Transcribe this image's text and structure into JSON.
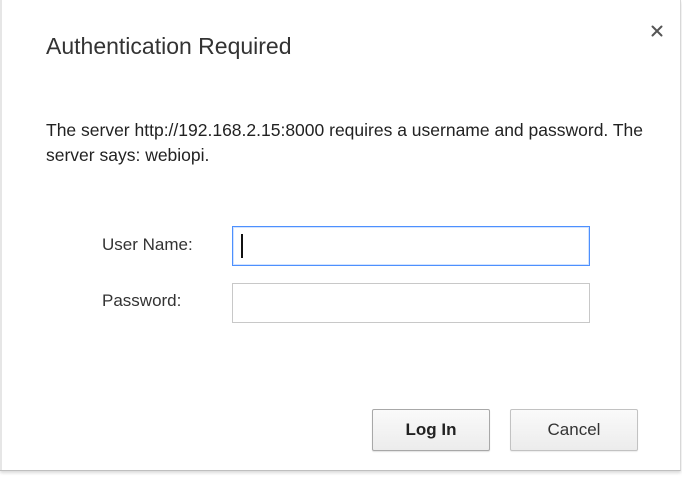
{
  "dialog": {
    "title": "Authentication Required",
    "message": "The server http://192.168.2.15:8000 requires a username and password. The server says: webiopi.",
    "close_icon": "close-icon",
    "colors": {
      "focus_border": "#4d90fe",
      "input_border": "#c8c8c8"
    }
  },
  "form": {
    "username_label": "User Name:",
    "username_value": "",
    "password_label": "Password:",
    "password_value": ""
  },
  "buttons": {
    "login_label": "Log In",
    "cancel_label": "Cancel"
  }
}
